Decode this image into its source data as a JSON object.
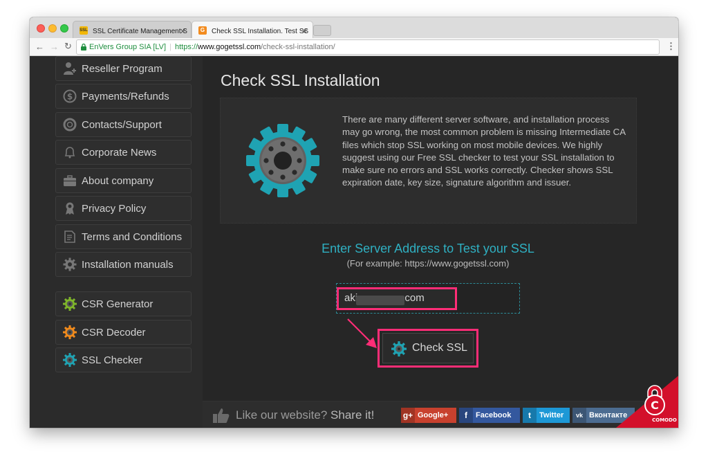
{
  "browser": {
    "tabs": [
      {
        "label": "SSL Certificate Management S",
        "favicon": "SSL"
      },
      {
        "label": "Check SSL Installation. Test SS",
        "favicon": "G"
      }
    ],
    "secure_label": "EnVers Group SIA [LV]",
    "url_scheme": "https://",
    "url_host": "www.gogetssl.com",
    "url_path": "/check-ssl-installation/"
  },
  "sidebar": {
    "items": [
      {
        "label": "Reseller Program",
        "icon": "reseller-icon"
      },
      {
        "label": "Payments/Refunds",
        "icon": "dollar-icon"
      },
      {
        "label": "Contacts/Support",
        "icon": "lifebuoy-icon"
      },
      {
        "label": "Corporate News",
        "icon": "bell-icon"
      },
      {
        "label": "About company",
        "icon": "briefcase-icon"
      },
      {
        "label": "Privacy Policy",
        "icon": "ribbon-icon"
      },
      {
        "label": "Terms and Conditions",
        "icon": "document-icon"
      },
      {
        "label": "Installation manuals",
        "icon": "gear-icon"
      }
    ],
    "tools": [
      {
        "label": "CSR Generator",
        "icon": "gear-icon",
        "color": "#7fb52a"
      },
      {
        "label": "CSR Decoder",
        "icon": "gear-icon",
        "color": "#f08a1c"
      },
      {
        "label": "SSL Checker",
        "icon": "gear-icon",
        "color": "#1fa3b3"
      }
    ]
  },
  "main": {
    "title": "Check SSL Installation",
    "description": "There are many different server software, and installation process may go wrong, the most common problem is missing Intermediate CA files which stop SSL working on most mobile devices. We highly suggest using our Free SSL checker to test your SSL installation to make sure no errors and SSL works correctly. Checker shows SSL expiration date, key size, signature algorithm and issuer.",
    "prompt": "Enter Server Address to Test your SSL",
    "example": "(For example: https://www.gogetssl.com)",
    "input_prefix": "aki",
    "input_suffix": ".com",
    "check_button": "Check SSL"
  },
  "footer": {
    "like_text": "Like our website?",
    "share_text": "Share it!",
    "buttons": [
      {
        "label": "Google+",
        "icon": "g+",
        "color": "#c8412e"
      },
      {
        "label": "Facebook",
        "icon": "f",
        "color": "#34589e"
      },
      {
        "label": "Twitter",
        "icon": "t",
        "color": "#1d98d6"
      },
      {
        "label": "Вконтакте",
        "icon": "vk",
        "color": "#4c6c91"
      }
    ],
    "badge_text": "COMODO"
  },
  "colors": {
    "accent": "#2fb0c2",
    "highlight": "#ff2d77",
    "background": "#262626"
  }
}
